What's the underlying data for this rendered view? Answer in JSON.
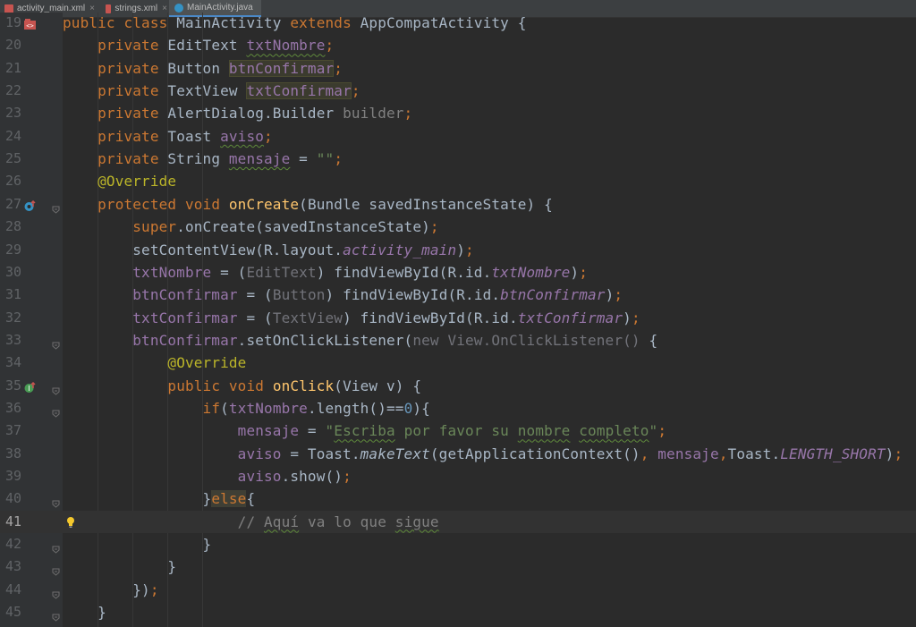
{
  "tabs": [
    {
      "label": "activity_main.xml",
      "active": false,
      "icon": "xml-file-icon",
      "color": "#c75450"
    },
    {
      "label": "strings.xml",
      "active": false,
      "icon": "xml-file-icon",
      "color": "#c75450"
    },
    {
      "label": "MainActivity.java",
      "active": true,
      "icon": "java-class-icon",
      "color": "#3592c4"
    }
  ],
  "tab_close_glyph": "×",
  "lines": [
    {
      "n": "19",
      "tokens": [
        [
          "kw",
          "public "
        ],
        [
          "kw",
          "class "
        ],
        [
          "plain",
          "MainActivity "
        ],
        [
          "kw",
          "extends "
        ],
        [
          "plain",
          "AppCompatActivity {"
        ]
      ]
    },
    {
      "n": "20",
      "tokens": [
        [
          "plain",
          "    "
        ],
        [
          "kw",
          "private "
        ],
        [
          "plain",
          "EditText "
        ],
        [
          "fld sq",
          "txtNombre"
        ],
        [
          "kw",
          ";"
        ]
      ]
    },
    {
      "n": "21",
      "tokens": [
        [
          "plain",
          "    "
        ],
        [
          "kw",
          "private "
        ],
        [
          "plain",
          "Button "
        ],
        [
          "fld hl",
          "btnConfirmar"
        ],
        [
          "kw",
          ";"
        ]
      ]
    },
    {
      "n": "22",
      "tokens": [
        [
          "plain",
          "    "
        ],
        [
          "kw",
          "private "
        ],
        [
          "plain",
          "TextView "
        ],
        [
          "fld hl",
          "txtConfirmar"
        ],
        [
          "kw",
          ";"
        ]
      ]
    },
    {
      "n": "23",
      "tokens": [
        [
          "plain",
          "    "
        ],
        [
          "kw",
          "private "
        ],
        [
          "plain",
          "AlertDialog.Builder "
        ],
        [
          "gray",
          "builder"
        ],
        [
          "kw",
          ";"
        ]
      ]
    },
    {
      "n": "24",
      "tokens": [
        [
          "plain",
          "    "
        ],
        [
          "kw",
          "private "
        ],
        [
          "plain",
          "Toast "
        ],
        [
          "fld sq",
          "aviso"
        ],
        [
          "kw",
          ";"
        ]
      ]
    },
    {
      "n": "25",
      "tokens": [
        [
          "plain",
          "    "
        ],
        [
          "kw",
          "private "
        ],
        [
          "plain",
          "String "
        ],
        [
          "fld sq",
          "mensaje"
        ],
        [
          "plain",
          " = "
        ],
        [
          "str",
          "\"\""
        ],
        [
          "kw",
          ";"
        ]
      ]
    },
    {
      "n": "26",
      "tokens": [
        [
          "plain",
          "    "
        ],
        [
          "an",
          "@Override"
        ]
      ]
    },
    {
      "n": "27",
      "tokens": [
        [
          "plain",
          "    "
        ],
        [
          "kw",
          "protected "
        ],
        [
          "kw",
          "void "
        ],
        [
          "fn",
          "onCreate"
        ],
        [
          "plain",
          "(Bundle savedInstanceState) {"
        ]
      ]
    },
    {
      "n": "28",
      "tokens": [
        [
          "plain",
          "        "
        ],
        [
          "kw",
          "super"
        ],
        [
          "plain",
          ".onCreate(savedInstanceState)"
        ],
        [
          "kw",
          ";"
        ]
      ]
    },
    {
      "n": "29",
      "tokens": [
        [
          "plain",
          "        setContentView(R.layout."
        ],
        [
          "fld it",
          "activity_main"
        ],
        [
          "plain",
          ")"
        ],
        [
          "kw",
          ";"
        ]
      ]
    },
    {
      "n": "30",
      "tokens": [
        [
          "plain",
          "        "
        ],
        [
          "fld",
          "txtNombre"
        ],
        [
          "plain",
          " = ("
        ],
        [
          "dim",
          "EditText"
        ],
        [
          "plain",
          ") findViewById(R.id."
        ],
        [
          "fld it",
          "txtNombre"
        ],
        [
          "plain",
          ")"
        ],
        [
          "kw",
          ";"
        ]
      ]
    },
    {
      "n": "31",
      "tokens": [
        [
          "plain",
          "        "
        ],
        [
          "fld",
          "btnConfirmar"
        ],
        [
          "plain",
          " = ("
        ],
        [
          "dim",
          "Button"
        ],
        [
          "plain",
          ") findViewById(R.id."
        ],
        [
          "fld it",
          "btnConfirmar"
        ],
        [
          "plain",
          ")"
        ],
        [
          "kw",
          ";"
        ]
      ]
    },
    {
      "n": "32",
      "tokens": [
        [
          "plain",
          "        "
        ],
        [
          "fld",
          "txtConfirmar"
        ],
        [
          "plain",
          " = ("
        ],
        [
          "dim",
          "TextView"
        ],
        [
          "plain",
          ") findViewById(R.id."
        ],
        [
          "fld it",
          "txtConfirmar"
        ],
        [
          "plain",
          ")"
        ],
        [
          "kw",
          ";"
        ]
      ]
    },
    {
      "n": "33",
      "tokens": [
        [
          "plain",
          "        "
        ],
        [
          "fld",
          "btnConfirmar"
        ],
        [
          "plain",
          ".setOnClickListener("
        ],
        [
          "dim",
          "new View.OnClickListener()"
        ],
        [
          "plain",
          " {"
        ]
      ]
    },
    {
      "n": "34",
      "tokens": [
        [
          "plain",
          "            "
        ],
        [
          "an",
          "@Override"
        ]
      ]
    },
    {
      "n": "35",
      "tokens": [
        [
          "plain",
          "            "
        ],
        [
          "kw",
          "public "
        ],
        [
          "kw",
          "void "
        ],
        [
          "fn",
          "onClick"
        ],
        [
          "plain",
          "(View v) {"
        ]
      ]
    },
    {
      "n": "36",
      "tokens": [
        [
          "plain",
          "                "
        ],
        [
          "kw",
          "if"
        ],
        [
          "plain",
          "("
        ],
        [
          "fld",
          "txtNombre"
        ],
        [
          "plain",
          ".length()=="
        ],
        [
          "num",
          "0"
        ],
        [
          "plain",
          "){"
        ]
      ]
    },
    {
      "n": "37",
      "tokens": [
        [
          "plain",
          "                    "
        ],
        [
          "fld",
          "mensaje"
        ],
        [
          "plain",
          " = "
        ],
        [
          "str",
          "\""
        ],
        [
          "str sq",
          "Escriba"
        ],
        [
          "str",
          " por favor su "
        ],
        [
          "str sq",
          "nombre"
        ],
        [
          "str",
          " "
        ],
        [
          "str sq",
          "completo"
        ],
        [
          "str",
          "\""
        ],
        [
          "kw",
          ";"
        ]
      ]
    },
    {
      "n": "38",
      "tokens": [
        [
          "plain",
          "                    "
        ],
        [
          "fld",
          "aviso"
        ],
        [
          "plain",
          " = Toast."
        ],
        [
          "plain it",
          "makeText"
        ],
        [
          "plain",
          "(getApplicationContext()"
        ],
        [
          "kw",
          ", "
        ],
        [
          "fld",
          "mensaje"
        ],
        [
          "kw",
          ","
        ],
        [
          "plain",
          "Toast."
        ],
        [
          "fld it",
          "LENGTH_SHORT"
        ],
        [
          "plain",
          ")"
        ],
        [
          "kw",
          ";"
        ]
      ]
    },
    {
      "n": "39",
      "tokens": [
        [
          "plain",
          "                    "
        ],
        [
          "fld",
          "aviso"
        ],
        [
          "plain",
          ".show()"
        ],
        [
          "kw",
          ";"
        ]
      ]
    },
    {
      "n": "40",
      "tokens": [
        [
          "plain",
          "                }"
        ],
        [
          "kw hlb",
          "else"
        ],
        [
          "plain",
          "{"
        ]
      ]
    },
    {
      "n": "41",
      "tokens": [
        [
          "plain",
          "                    "
        ],
        [
          "cm",
          "// "
        ],
        [
          "cm sq",
          "Aquí"
        ],
        [
          "cm",
          " va lo que "
        ],
        [
          "cm sq",
          "sigue"
        ]
      ]
    },
    {
      "n": "42",
      "tokens": [
        [
          "plain",
          "                }"
        ]
      ]
    },
    {
      "n": "43",
      "tokens": [
        [
          "plain",
          "            }"
        ]
      ]
    },
    {
      "n": "44",
      "tokens": [
        [
          "plain",
          "        })"
        ],
        [
          "kw",
          ";"
        ]
      ]
    },
    {
      "n": "45",
      "tokens": [
        [
          "plain",
          "    }"
        ]
      ]
    }
  ],
  "gutter_marks": {
    "19": "class-structure-icon",
    "27": "override-method-icon",
    "35": "implement-method-icon",
    "41": "lightbulb-icon"
  },
  "fold_lines": [
    "27",
    "33",
    "35",
    "36",
    "40",
    "42",
    "43",
    "44",
    "45"
  ],
  "current_line": "41",
  "colors": {
    "background": "#2b2b2b",
    "gutter": "#313335",
    "keyword": "#cc7832",
    "field": "#9876aa",
    "method": "#ffc66d",
    "annotation": "#bbb529",
    "string": "#6a8759",
    "number": "#6897bb",
    "comment": "#808080"
  }
}
